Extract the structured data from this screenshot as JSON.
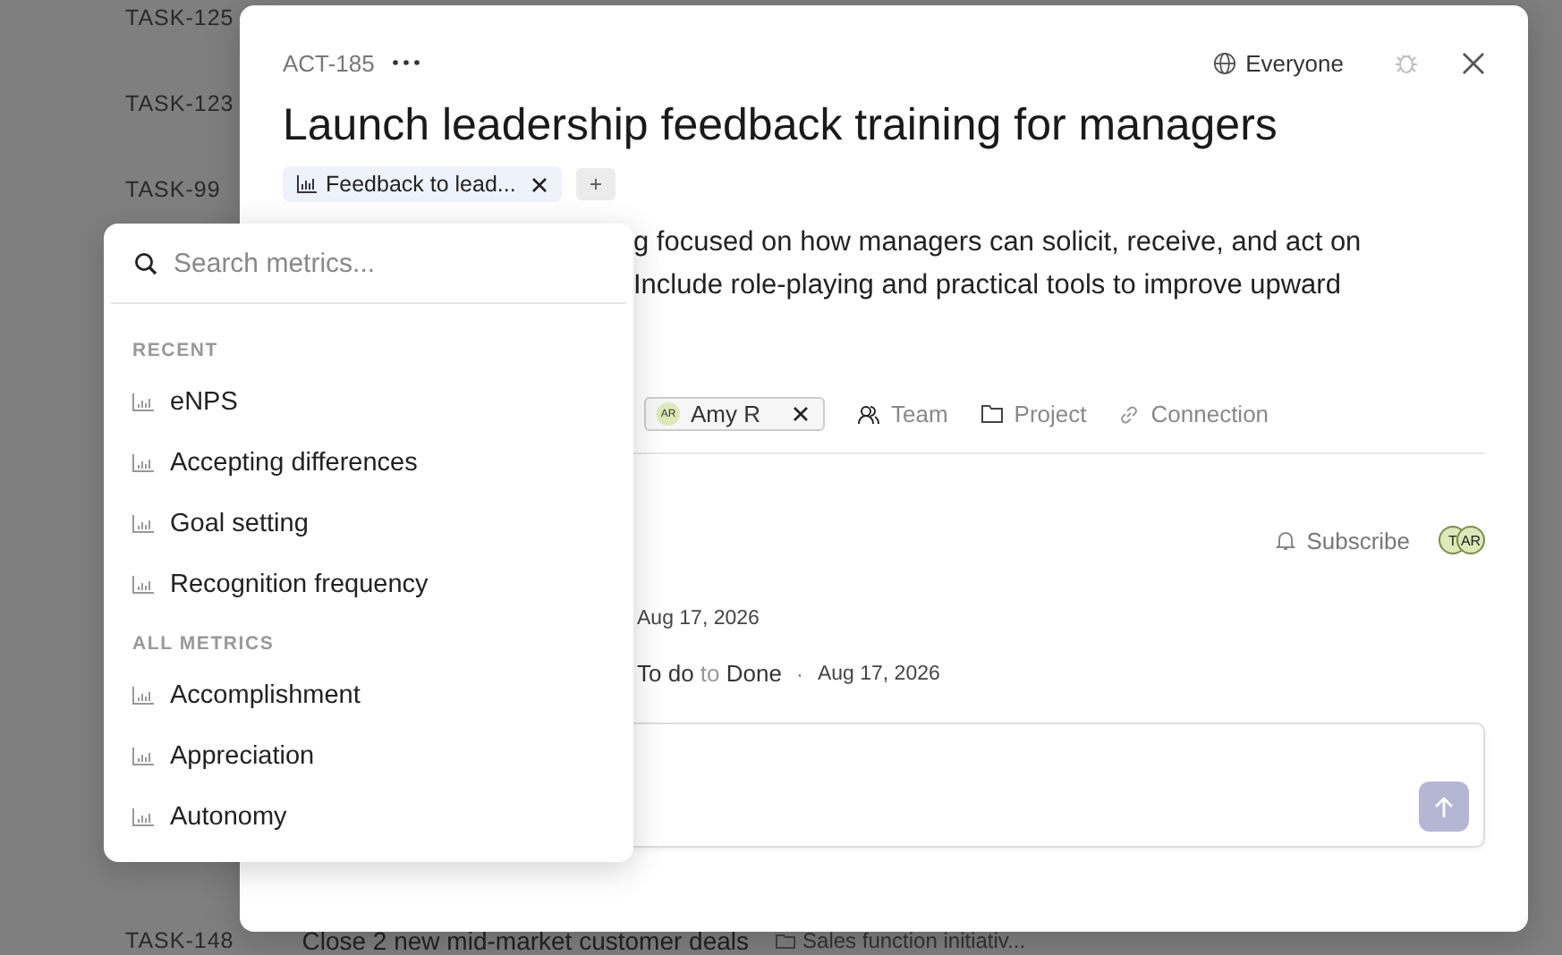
{
  "background_tasks": [
    {
      "id": "TASK-125"
    },
    {
      "id": "TASK-123"
    },
    {
      "id": "TASK-99"
    }
  ],
  "bottom_task": {
    "id": "TASK-148",
    "title": "Close 2 new mid-market customer deals",
    "initiative": "Sales function initiativ..."
  },
  "modal": {
    "key": "ACT-185",
    "visibility": "Everyone",
    "title": "Launch leadership feedback training for managers",
    "tags": [
      {
        "label": "Feedback to lead..."
      }
    ],
    "description_lines": [
      "g focused on how managers can solicit, receive, and act on",
      "Include role-playing and practical tools to improve upward"
    ],
    "assignee": {
      "initials": "AR",
      "name": "Amy R"
    },
    "fields": [
      {
        "kind": "team",
        "label": "Team"
      },
      {
        "kind": "project",
        "label": "Project"
      },
      {
        "kind": "link",
        "label": "Connection"
      }
    ],
    "subscribe": "Subscribe",
    "subscribers": [
      "T",
      "AR"
    ],
    "activity": [
      {
        "kind": "date",
        "date": "Aug 17, 2026"
      },
      {
        "kind": "status",
        "from": "To do",
        "connector": "to",
        "to": "Done",
        "separator": "·",
        "date": "Aug 17, 2026"
      }
    ]
  },
  "metric_picker": {
    "placeholder": "Search metrics...",
    "sections": [
      {
        "heading": "RECENT",
        "items": [
          "eNPS",
          "Accepting differences",
          "Goal setting",
          "Recognition frequency"
        ]
      },
      {
        "heading": "ALL METRICS",
        "items": [
          "Accomplishment",
          "Appreciation",
          "Autonomy"
        ]
      }
    ]
  }
}
